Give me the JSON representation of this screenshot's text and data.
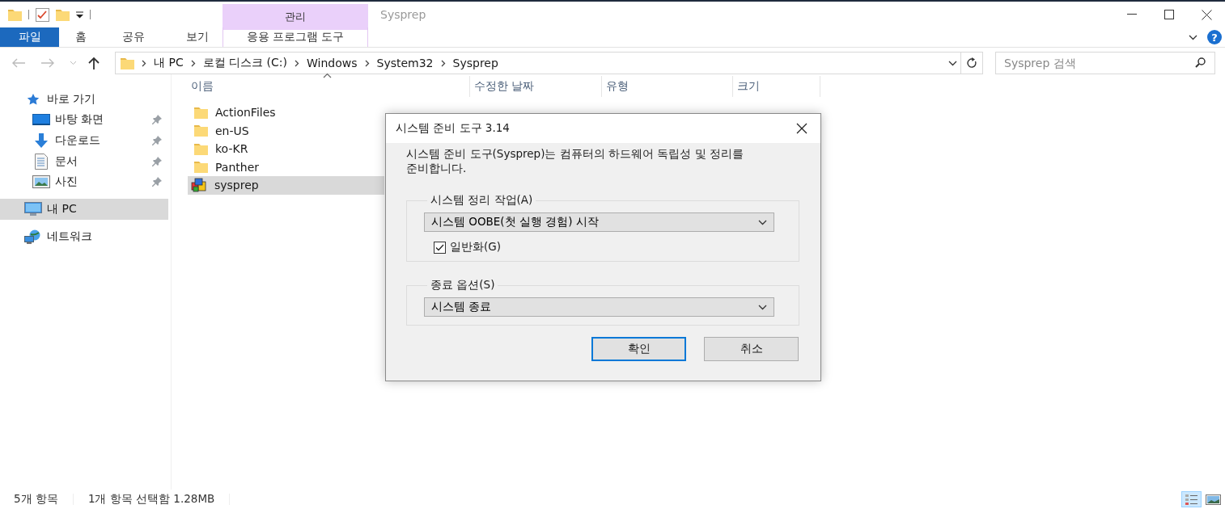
{
  "window": {
    "title": "Sysprep"
  },
  "ribbon": {
    "contextual_group": "관리",
    "help": "?",
    "tabs": [
      {
        "label": "파일",
        "kind": "file",
        "selected": false
      },
      {
        "label": "홈",
        "kind": "tab",
        "selected": false
      },
      {
        "label": "공유",
        "kind": "tab",
        "selected": false
      },
      {
        "label": "보기",
        "kind": "tab",
        "selected": false
      },
      {
        "label": "응용 프로그램 도구",
        "kind": "contextual",
        "selected": false
      }
    ]
  },
  "address_bar": {
    "path": [
      "내 PC",
      "로컬 디스크 (C:)",
      "Windows",
      "System32",
      "Sysprep"
    ]
  },
  "search": {
    "placeholder": "Sysprep 검색"
  },
  "nav_pane": {
    "items": [
      {
        "label": "바로 가기",
        "kind": "star",
        "selected": false,
        "children": [
          {
            "label": "바탕 화면",
            "kind": "desktop",
            "selected": false,
            "pinned": true
          },
          {
            "label": "다운로드",
            "kind": "download",
            "selected": false,
            "pinned": true
          },
          {
            "label": "문서",
            "kind": "document",
            "selected": false,
            "pinned": true
          },
          {
            "label": "사진",
            "kind": "pictures",
            "selected": false,
            "pinned": true
          }
        ]
      },
      {
        "label": "내 PC",
        "kind": "pc",
        "selected": true
      },
      {
        "label": "네트워크",
        "kind": "network",
        "selected": false
      }
    ]
  },
  "file_list": {
    "columns": [
      "이름",
      "수정한 날짜",
      "유형",
      "크기"
    ],
    "rows": [
      {
        "name": "ActionFiles",
        "kind": "folder",
        "selected": false
      },
      {
        "name": "en-US",
        "kind": "folder",
        "selected": false
      },
      {
        "name": "ko-KR",
        "kind": "folder",
        "selected": false
      },
      {
        "name": "Panther",
        "kind": "folder",
        "selected": false
      },
      {
        "name": "sysprep",
        "kind": "app",
        "selected": true
      }
    ]
  },
  "dialog": {
    "title": "시스템 준비 도구 3.14",
    "description": "시스템 준비 도구(Sysprep)는 컴퓨터의 하드웨어 독립성 및 정리를 준비합니다.",
    "groups": [
      {
        "legend": "시스템 정리 작업(A)",
        "value": "시스템 OOBE(첫 실행 경험) 시작",
        "checkbox": {
          "label": "일반화(G)",
          "checked": true
        }
      },
      {
        "legend": "종료 옵션(S)",
        "value": "시스템 종료"
      }
    ],
    "buttons": [
      {
        "label": "확인",
        "default": true
      },
      {
        "label": "취소",
        "default": false
      }
    ]
  },
  "status_bar": {
    "item_count": "5개 항목",
    "selection": "1개 항목 선택함 1.28MB",
    "view_buttons": [
      {
        "kind": "details",
        "selected": true
      },
      {
        "kind": "large_icons",
        "selected": false
      }
    ]
  }
}
